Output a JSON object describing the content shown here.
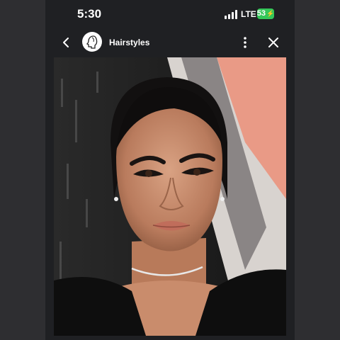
{
  "status_bar": {
    "time": "5:30",
    "network": "LTE",
    "battery": "53",
    "battery_color": "#34c759"
  },
  "app_bar": {
    "title": "Hairstyles",
    "back_icon": "chevron-left-icon",
    "more_icon": "vertical-dots-icon",
    "close_icon": "close-icon"
  },
  "photo": {
    "subject": "Portrait photo of a woman with slicked-back dark hair"
  }
}
